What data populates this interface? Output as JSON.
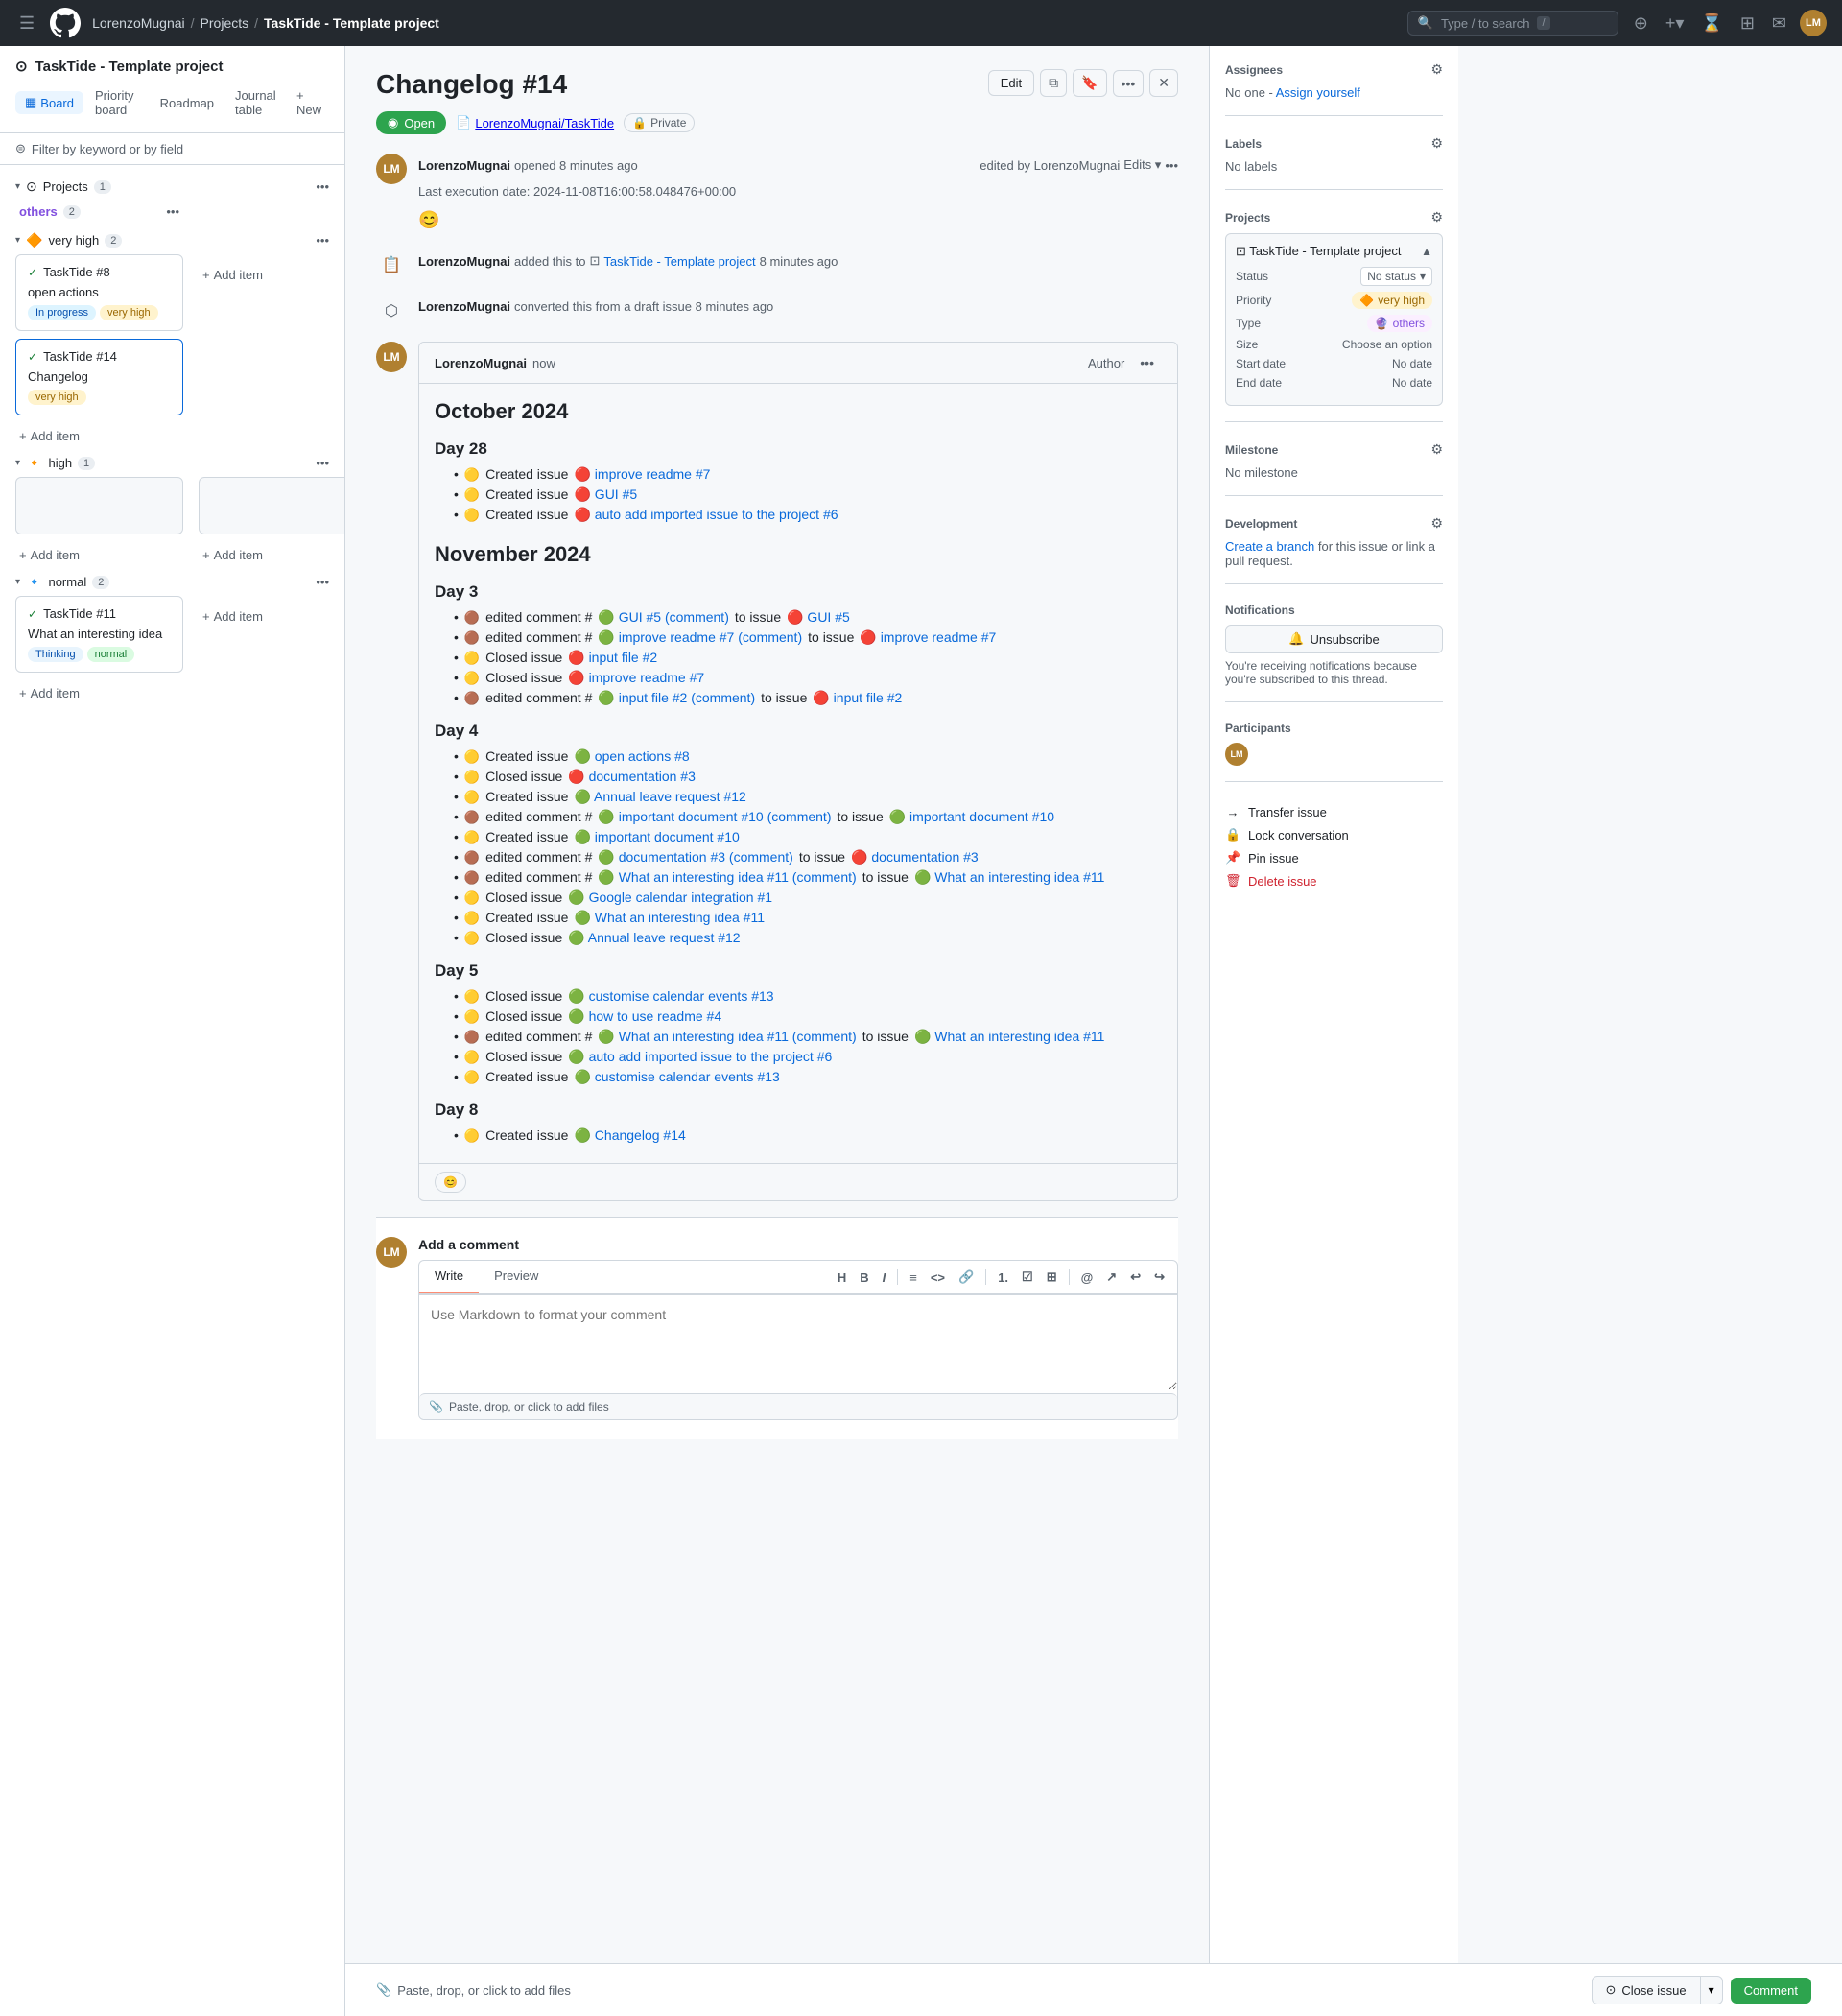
{
  "topnav": {
    "hamburger": "☰",
    "github_logo": "github",
    "breadcrumbs": [
      {
        "label": "LorenzoMugnai",
        "href": "#"
      },
      {
        "label": "Projects",
        "href": "#"
      },
      {
        "label": "TaskTide - Template project",
        "href": "#",
        "current": true
      }
    ],
    "search_placeholder": "Type / to search",
    "plus_label": "+",
    "actions": [
      "⌛",
      "⊞",
      "✉",
      "☰"
    ]
  },
  "left_panel": {
    "project_title": "TaskTide - Template project",
    "tabs": [
      {
        "label": "Board",
        "icon": "▦",
        "active": true
      },
      {
        "label": "Priority board",
        "icon": "≡",
        "active": false
      },
      {
        "label": "Roadmap",
        "icon": "📅",
        "active": false
      },
      {
        "label": "Journal table",
        "icon": "📋",
        "active": false
      },
      {
        "label": "+ New",
        "active": false
      }
    ],
    "filter_placeholder": "Filter by keyword or by field",
    "groups": [
      {
        "name": "Projects",
        "icon": "⊙",
        "count": 1,
        "priority": "none",
        "columns": [
          {
            "name": "others",
            "count": 2,
            "cards": []
          }
        ]
      },
      {
        "name": "very high",
        "icon": "🔶",
        "count": 2,
        "columns": [
          {
            "name": "col1",
            "cards": [
              {
                "id": "TaskTide #8",
                "title": "open actions",
                "badges": [
                  {
                    "label": "In progress",
                    "type": "blue"
                  },
                  {
                    "label": "very high",
                    "type": "orange"
                  }
                ]
              },
              {
                "id": "TaskTide #14",
                "title": "Changelog",
                "badges": [
                  {
                    "label": "very high",
                    "type": "orange"
                  }
                ]
              }
            ]
          }
        ]
      },
      {
        "name": "high",
        "icon": "🔸",
        "count": 1,
        "columns": [
          {
            "name": "col1",
            "cards": [
              {
                "id": "",
                "title": "",
                "badges": []
              }
            ]
          },
          {
            "name": "col2",
            "cards": [
              {
                "id": "",
                "title": "",
                "badges": []
              }
            ]
          }
        ]
      },
      {
        "name": "normal",
        "icon": "🔹",
        "count": 2,
        "columns": [
          {
            "name": "col1",
            "cards": [
              {
                "id": "TaskTide #11",
                "title": "What an interesting idea",
                "badges": [
                  {
                    "label": "Thinking",
                    "type": "thinking"
                  },
                  {
                    "label": "normal",
                    "type": "green"
                  }
                ]
              }
            ]
          },
          {
            "name": "col2",
            "cards": []
          }
        ]
      }
    ]
  },
  "issue": {
    "title": "Changelog #14",
    "status": "Open",
    "repo": "LorenzoMugnai/TaskTide",
    "visibility": "Private",
    "opened_by": "LorenzoMugnai",
    "opened_time": "opened 8 minutes ago",
    "edited_by": "edited by LorenzoMugnai",
    "last_execution": "Last execution date: 2024-11-08T16:00:58.048476+00:00",
    "timeline": [
      {
        "type": "action",
        "icon": "📋",
        "text": "LorenzoMugnai added this to ⊡ TaskTide - Template project 8 minutes ago"
      },
      {
        "type": "action",
        "icon": "⬡",
        "text": "LorenzoMugnai converted this from a draft issue 8 minutes ago"
      }
    ],
    "comments": [
      {
        "author": "LorenzoMugnai",
        "time": "now",
        "role": "Author",
        "sections": [
          {
            "heading": "October 2024",
            "days": [
              {
                "day": "Day 28",
                "items": [
                  "🟡 Created issue 🔴 improve readme #7",
                  "🟡 Created issue 🔴 GUI #5",
                  "🟡 Created issue 🔴 auto add imported issue to the project #6"
                ]
              }
            ]
          },
          {
            "heading": "November 2024",
            "days": [
              {
                "day": "Day 3",
                "items": [
                  "🟤 edited comment #🟢 GUI #5 (comment) to issue 🔴 GUI #5",
                  "🟤 edited comment #🟢 improve readme #7 (comment) to issue 🔴 improve readme #7",
                  "🟡 Closed issue 🔴 input file #2",
                  "🟡 Closed issue 🔴 improve readme #7",
                  "🟤 edited comment #🟢 input file #2 (comment) to issue 🔴 input file #2"
                ]
              },
              {
                "day": "Day 4",
                "items": [
                  "🟡 Created issue 🟢 open actions #8",
                  "🟡 Closed issue 🔴 documentation #3",
                  "🟡 Created issue 🟢 Annual leave request #12",
                  "🟤 edited comment #🟢 important document #10 (comment) to issue 🟢 important document #10",
                  "🟡 Created issue 🟢 important document #10",
                  "🟤 edited comment #🟢 documentation #3 (comment) to issue 🔴 documentation #3",
                  "🟤 edited comment #🟢 What an interesting idea #11 (comment) to issue 🟢 What an interesting idea #11",
                  "🟡 Closed issue 🟢 Google calendar integration #1",
                  "🟡 Created issue 🟢 What an interesting idea #11",
                  "🟡 Closed issue 🟢 Annual leave request #12"
                ]
              },
              {
                "day": "Day 5",
                "items": [
                  "🟡 Closed issue 🟢 customise calendar events #13",
                  "🟡 Closed issue 🟢 how to use readme #4",
                  "🟤 edited comment #🟢 What an interesting idea #11 (comment) to issue 🟢 What an interesting idea #11",
                  "🟡 Closed issue 🟢 auto add imported issue to the project #6",
                  "🟡 Created issue 🟢 customise calendar events #13"
                ]
              },
              {
                "day": "Day 8",
                "items": [
                  "🟡 Created issue 🟢 Changelog #14"
                ]
              }
            ]
          }
        ]
      }
    ],
    "add_comment": {
      "placeholder": "Use Markdown to format your comment",
      "write_tab": "Write",
      "preview_tab": "Preview",
      "attach_text": "Paste, drop, or click to add files",
      "close_issue_label": "Close issue",
      "comment_label": "Comment"
    }
  },
  "issue_sidebar": {
    "assignees_label": "Assignees",
    "assignees_value": "No one",
    "assign_link": "Assign yourself",
    "labels_label": "Labels",
    "labels_value": "No labels",
    "projects_label": "Projects",
    "project_name": "TaskTide - Template project",
    "status_label": "Status",
    "status_value": "No status",
    "priority_label": "Priority",
    "priority_value": "very high",
    "type_label": "Type",
    "type_value": "others",
    "size_label": "Size",
    "size_value": "Choose an option",
    "start_date_label": "Start date",
    "start_date_value": "No date",
    "end_date_label": "End date",
    "end_date_value": "No date",
    "milestone_label": "Milestone",
    "milestone_value": "No milestone",
    "development_label": "Development",
    "dev_link_text": "Create a branch",
    "dev_text_after": "for this issue or link a pull request.",
    "notifications_label": "Notifications",
    "unsubscribe_label": "Unsubscribe",
    "notif_text": "You're receiving notifications because you're subscribed to this thread.",
    "participants_label": "Participants",
    "transfer_issue": "Transfer issue",
    "lock_conversation": "Lock conversation",
    "pin_issue": "Pin issue",
    "delete_issue": "Delete issue"
  }
}
